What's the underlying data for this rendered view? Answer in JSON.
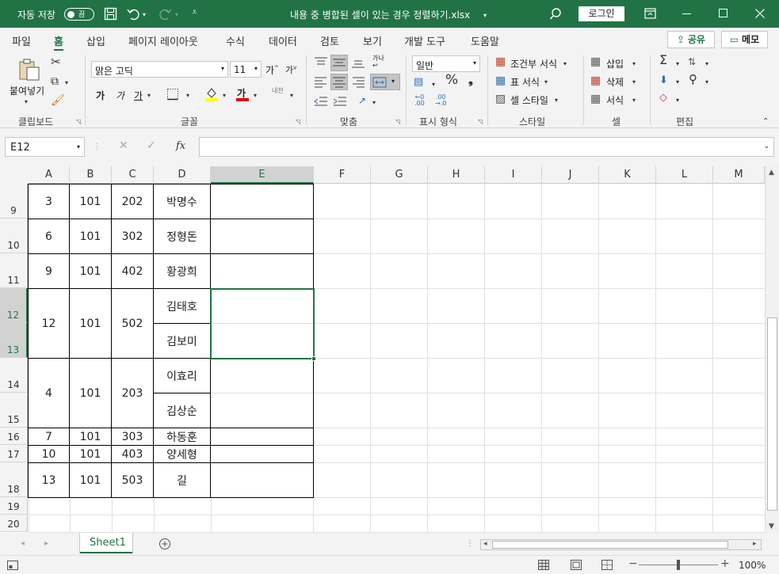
{
  "titlebar": {
    "autosave_label": "자동 저장",
    "autosave_state": "끔",
    "title": "내용 중 병합된 셀이 있는 경우 정렬하기.xlsx",
    "login_label": "로그인"
  },
  "tabs": [
    "파일",
    "홈",
    "삽입",
    "페이지 레이아웃",
    "수식",
    "데이터",
    "검토",
    "보기",
    "개발 도구",
    "도움말"
  ],
  "active_tab": "홈",
  "share_label": "공유",
  "memo_label": "메모",
  "ribbon": {
    "paste_label": "붙여넣기",
    "clipboard_label": "클립보드",
    "font_name": "맑은 고딕",
    "font_size": "11",
    "font_group_label": "글꼴",
    "bold": "가",
    "italic": "가",
    "underline": "가",
    "increase_font": "가",
    "decrease_font": "가",
    "font_color_glyph": "가",
    "phonetic": "내천",
    "align_group_label": "맞춤",
    "number_format": "일반",
    "number_group_label": "표시 형식",
    "conditional_format": "조건부 서식",
    "format_table": "표 서식",
    "cell_styles": "셀 스타일",
    "styles_group_label": "스타일",
    "insert": "삽입",
    "delete": "삭제",
    "format": "서식",
    "cells_group_label": "셀",
    "editing_group_label": "편집",
    "wrap_glyph": "가나"
  },
  "formula_bar": {
    "name_box": "E12",
    "fx": "fx",
    "value": ""
  },
  "columns": [
    "A",
    "B",
    "C",
    "D",
    "E",
    "F",
    "G",
    "H",
    "I",
    "J",
    "K",
    "L",
    "M"
  ],
  "selected_column": "E",
  "rows": [
    "9",
    "10",
    "11",
    "12",
    "13",
    "14",
    "15",
    "16",
    "17",
    "18",
    "19",
    "20"
  ],
  "selected_rows": [
    "12",
    "13"
  ],
  "cells": {
    "r9": [
      "3",
      "101",
      "202",
      "박명수"
    ],
    "r10": [
      "6",
      "101",
      "302",
      "정형돈"
    ],
    "r11": [
      "9",
      "101",
      "402",
      "황광희"
    ],
    "r12_13": [
      "12",
      "101",
      "502"
    ],
    "r12_D": "김태호",
    "r13_D": "김보미",
    "r14_15": [
      "4",
      "101",
      "203"
    ],
    "r14_D": "이효리",
    "r15_D": "김상순",
    "r16": [
      "7",
      "101",
      "303",
      "하동훈"
    ],
    "r17": [
      "10",
      "101",
      "403",
      "양세형"
    ],
    "r18": [
      "13",
      "101",
      "503",
      "길"
    ]
  },
  "sheet_tab": "Sheet1",
  "zoom": "100%",
  "colors": {
    "accent": "#217346",
    "ribbon_bg": "#f3f3f3"
  }
}
